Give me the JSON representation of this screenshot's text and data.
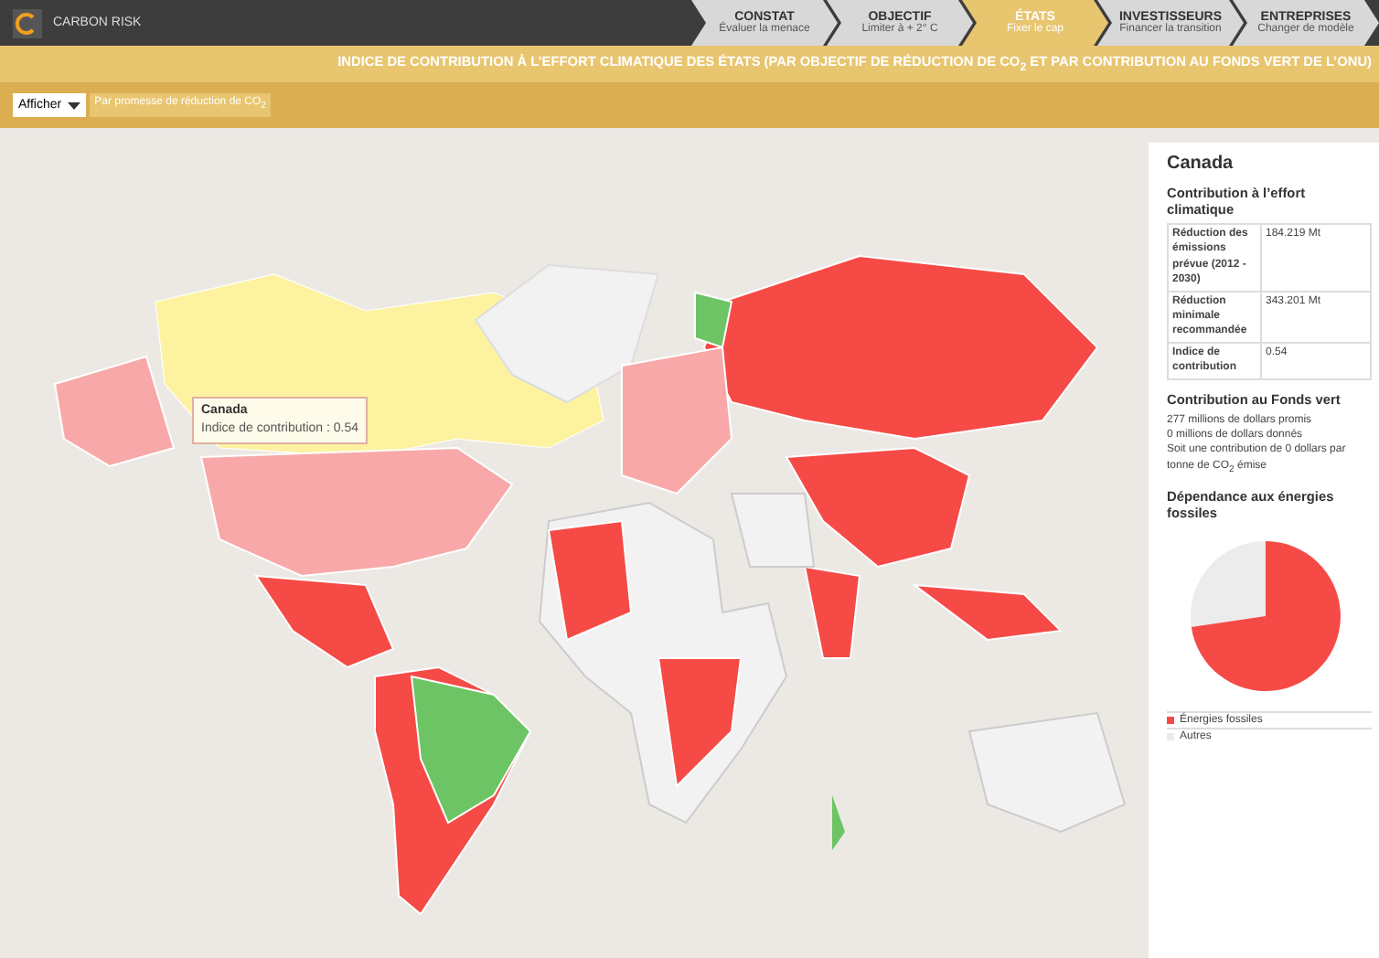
{
  "brand": {
    "name": "CARBON RISK"
  },
  "steps": [
    {
      "title": "CONSTAT",
      "subtitle": "Évaluer la menace",
      "selected": false
    },
    {
      "title": "OBJECTIF",
      "subtitle": "Limiter à + 2° C",
      "selected": false
    },
    {
      "title": "ÉTATS",
      "subtitle": "Fixer le cap",
      "selected": true
    },
    {
      "title": "INVESTISSEURS",
      "subtitle": "Financer la transition",
      "selected": false
    },
    {
      "title": "ENTREPRISES",
      "subtitle": "Changer de modèle",
      "selected": false
    }
  ],
  "headline": "INDICE DE CONTRIBUTION À L’EFFORT CLIMATIQUE DES ÉTATS (PAR OBJECTIF DE RÉDUCTION DE CO$_{2}$ ET PAR CONTRIBUTION AU FONDS VERT DE L’ONU)",
  "filter": {
    "dropdown": "Afficher",
    "option": "Par promesse de réduction de CO$_{2}$"
  },
  "tooltip": {
    "title": "Canada",
    "text": "Indice de contribution : 0.54"
  },
  "panel": {
    "country": "Canada",
    "contribution_title": "Contribution à l’effort climatique",
    "rows": [
      {
        "label": "Réduction des émissions prévue (2012 - 2030)",
        "value": "184.219 Mt"
      },
      {
        "label": "Réduction minimale recommandée",
        "value": "343.201 Mt"
      },
      {
        "label": "Indice de contribution",
        "value": "0.54"
      }
    ],
    "fund_title": "Contribution au Fonds vert",
    "fund_lines": [
      "277 millions de dollars promis",
      "0 millions de dollars donnés",
      "Soit une contribution de 0 dollars par tonne de CO$_{2}$ émise"
    ],
    "dependence_title": "Dépendance aux énergies fossiles",
    "legend": [
      {
        "label": "Énergies fossiles",
        "color": "#f64a46"
      },
      {
        "label": "Autres",
        "color": "#ececec"
      }
    ]
  }
}
